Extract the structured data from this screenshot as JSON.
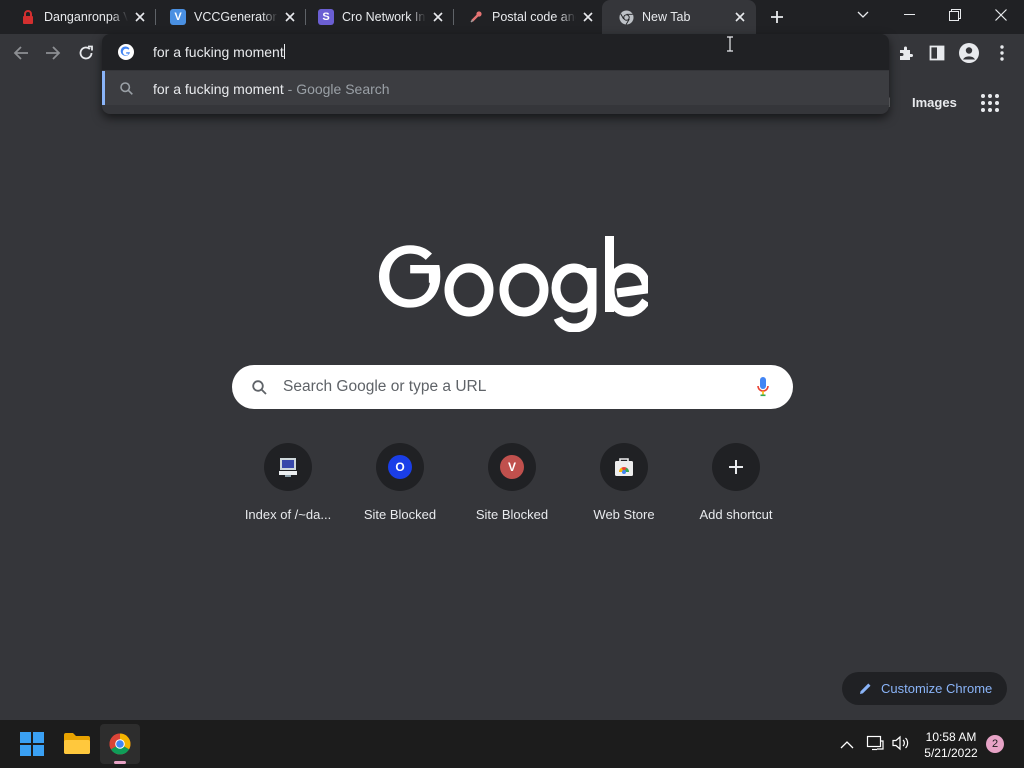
{
  "browser": {
    "tabs": [
      {
        "title": "Danganronpa V",
        "favicon": "lock-icon",
        "active": false
      },
      {
        "title": "VCCGenerator -",
        "favicon": "v-logo-icon",
        "active": false
      },
      {
        "title": "Cro Network Inc",
        "favicon": "s-logo-icon",
        "active": false
      },
      {
        "title": "Postal code and",
        "favicon": "pin-icon",
        "active": false
      },
      {
        "title": "New Tab",
        "favicon": "chrome-icon",
        "active": true
      }
    ],
    "favicon_letters": {
      "vcc": "V",
      "cro": "S"
    }
  },
  "omnibox": {
    "value": "for a fucking moment",
    "suggestion": {
      "query": "for a fucking moment",
      "separator": " - ",
      "source": "Google Search"
    }
  },
  "ntp": {
    "header_links": {
      "gmail_partial": "il",
      "images": "Images"
    },
    "search_placeholder": "Search Google or type a URL",
    "shortcuts": [
      {
        "label": "Index of /~da...",
        "icon": "computer-icon",
        "letter": ""
      },
      {
        "label": "Site Blocked",
        "icon": "letter-o-icon",
        "letter": "O"
      },
      {
        "label": "Site Blocked",
        "icon": "letter-v-icon",
        "letter": "V"
      },
      {
        "label": "Web Store",
        "icon": "web-store-icon",
        "letter": ""
      },
      {
        "label": "Add shortcut",
        "icon": "plus-icon",
        "letter": ""
      }
    ],
    "customize_label": "Customize Chrome"
  },
  "taskbar": {
    "time": "10:58 AM",
    "date": "5/21/2022",
    "notification_count": "2"
  },
  "colors": {
    "accent": "#8ab4f8",
    "tab_strip": "#202124",
    "toolbar": "#35363a",
    "shortcut_o": "#1a3ee8",
    "shortcut_v": "#c0504d"
  }
}
